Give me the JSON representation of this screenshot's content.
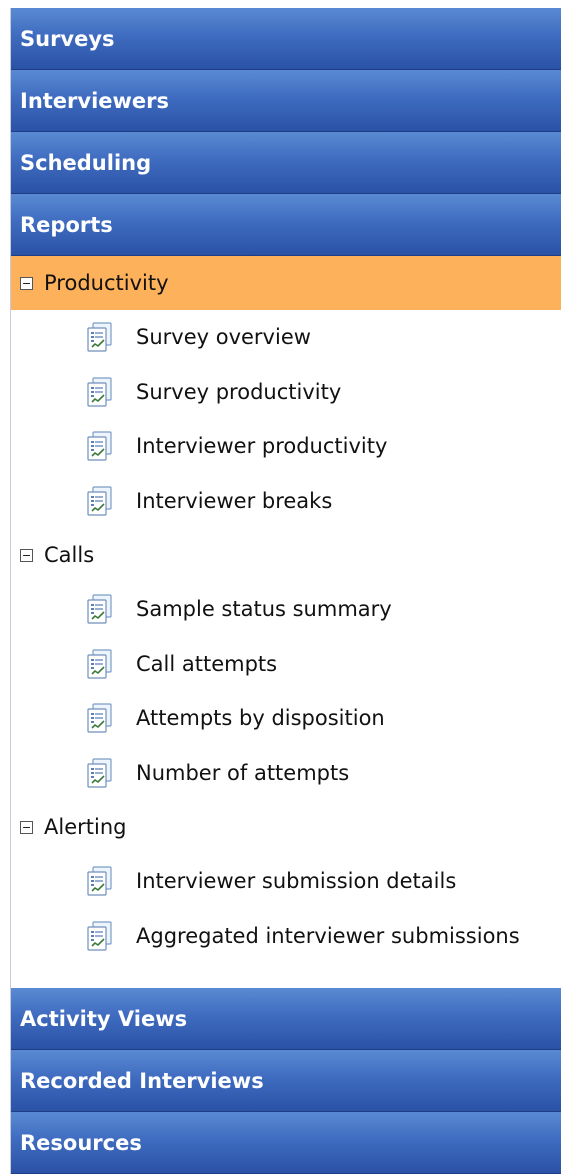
{
  "menu": {
    "top_headers": [
      "Surveys",
      "Interviewers",
      "Scheduling",
      "Reports"
    ],
    "bottom_headers": [
      "Activity Views",
      "Recorded Interviews",
      "Resources"
    ]
  },
  "reports_tree": {
    "groups": [
      {
        "label": "Productivity",
        "expanded": true,
        "selected": true,
        "items": [
          "Survey overview",
          "Survey productivity",
          "Interviewer productivity",
          "Interviewer breaks"
        ]
      },
      {
        "label": "Calls",
        "expanded": true,
        "selected": false,
        "items": [
          "Sample status summary",
          "Call attempts",
          "Attempts by disposition",
          "Number of attempts"
        ]
      },
      {
        "label": "Alerting",
        "expanded": true,
        "selected": false,
        "items": [
          "Interviewer submission details",
          "Aggregated interviewer submissions"
        ]
      }
    ],
    "item_icon": "report-icon",
    "toggle_icon": "collapse-minus-icon"
  },
  "colors": {
    "header_gradient_top": "#5b8ad3",
    "header_gradient_bottom": "#2a52a6",
    "selected_group_bg": "#fdb15b"
  }
}
